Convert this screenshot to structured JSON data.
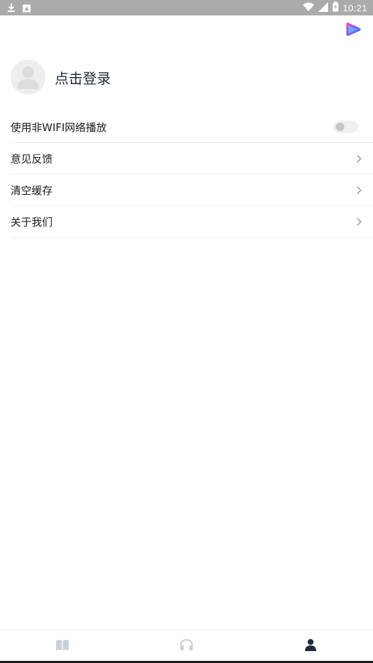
{
  "status_bar": {
    "time": "10:21",
    "icons": [
      "download-icon",
      "image-notification-icon",
      "wifi-icon",
      "signal-icon",
      "battery-icon"
    ]
  },
  "header": {
    "logo_icon": "app-logo-icon",
    "logo_colors": [
      "#3a8cff",
      "#ff4fa0",
      "#7a5cff"
    ]
  },
  "profile": {
    "avatar_icon": "user-avatar-icon",
    "login_label": "点击登录"
  },
  "settings": {
    "items": [
      {
        "label": "使用非WIFI网络播放",
        "control": "toggle",
        "enabled": false
      },
      {
        "label": "意见反馈",
        "control": "chevron-right-icon"
      },
      {
        "label": "清空缓存",
        "control": "chevron-right-icon"
      },
      {
        "label": "关于我们",
        "control": "chevron-right-icon"
      }
    ]
  },
  "bottom_nav": {
    "tabs": [
      {
        "icon": "book-icon",
        "active": false
      },
      {
        "icon": "headphones-icon",
        "active": false
      },
      {
        "icon": "person-icon",
        "active": true
      }
    ],
    "active_color": "#1f2b3a",
    "inactive_color": "#c8d0d8"
  }
}
